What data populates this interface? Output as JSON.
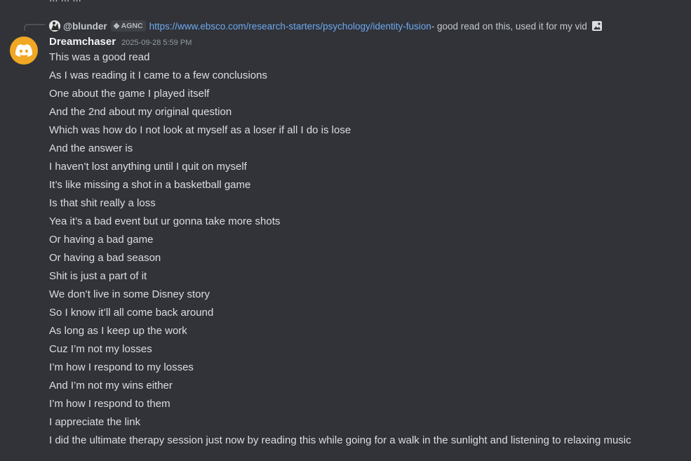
{
  "previous_message_cut": "...   ...   ...",
  "reply": {
    "username": "@blunder",
    "tag": "AGNC",
    "link": "https://www.ebsco.com/research-starters/psychology/identity-fusion",
    "text": " - good read on this, used it for my vid",
    "attachment_icon": "image-icon"
  },
  "author": {
    "name": "Dreamchaser",
    "timestamp": "2025-09-28 5:59 PM",
    "avatar_icon": "discord-logo",
    "avatar_color": "#F0A723"
  },
  "messages": [
    "This was a good read",
    "As I was reading it I came to a few conclusions",
    "One about the game I played itself",
    "And the 2nd about my original question",
    "Which was how do I not look at myself as a loser if all I do is lose",
    "And the answer is",
    "I haven’t lost anything until I quit on myself",
    "It’s like missing a shot in a basketball game",
    "Is that shit really a loss",
    "Yea it’s a bad event but ur gonna take more shots",
    "Or having a bad game",
    "Or having a bad season",
    "Shit is just a part of it",
    "We don’t live in some Disney story",
    "So I know it’ll all come back around",
    "As long as I keep up the work",
    "Cuz I’m not my losses",
    "I’m how I respond to my losses",
    "And I’m not my wins either",
    "I’m how I respond to them",
    "I appreciate the link",
    "I did the ultimate therapy session just now by reading this while going for a walk in the sunlight and listening to relaxing music"
  ],
  "colors": {
    "background": "#313338",
    "text": "#DBDEE1",
    "link": "#6EA9F0",
    "muted": "#949BA4"
  }
}
